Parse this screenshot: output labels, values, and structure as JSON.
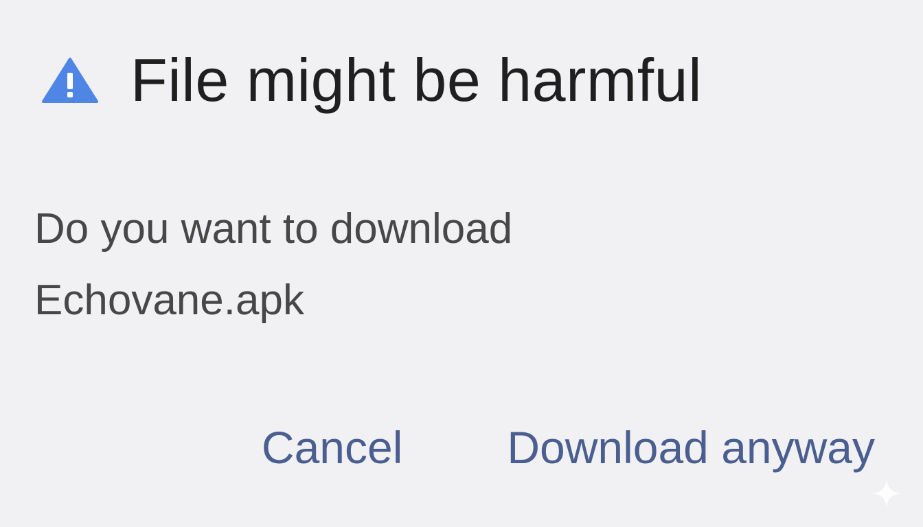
{
  "dialog": {
    "title": "File might be harmful",
    "icon": "warning-triangle-icon",
    "message_line1": "Do you want to download",
    "message_line2": "Echovane.apk",
    "cancel_label": "Cancel",
    "confirm_label": "Download anyway"
  },
  "colors": {
    "background": "#f1f1f4",
    "accent_icon": "#4f86e6",
    "title_text": "#1f1f1f",
    "body_text": "#474747",
    "button_text": "#4a5e8f"
  }
}
